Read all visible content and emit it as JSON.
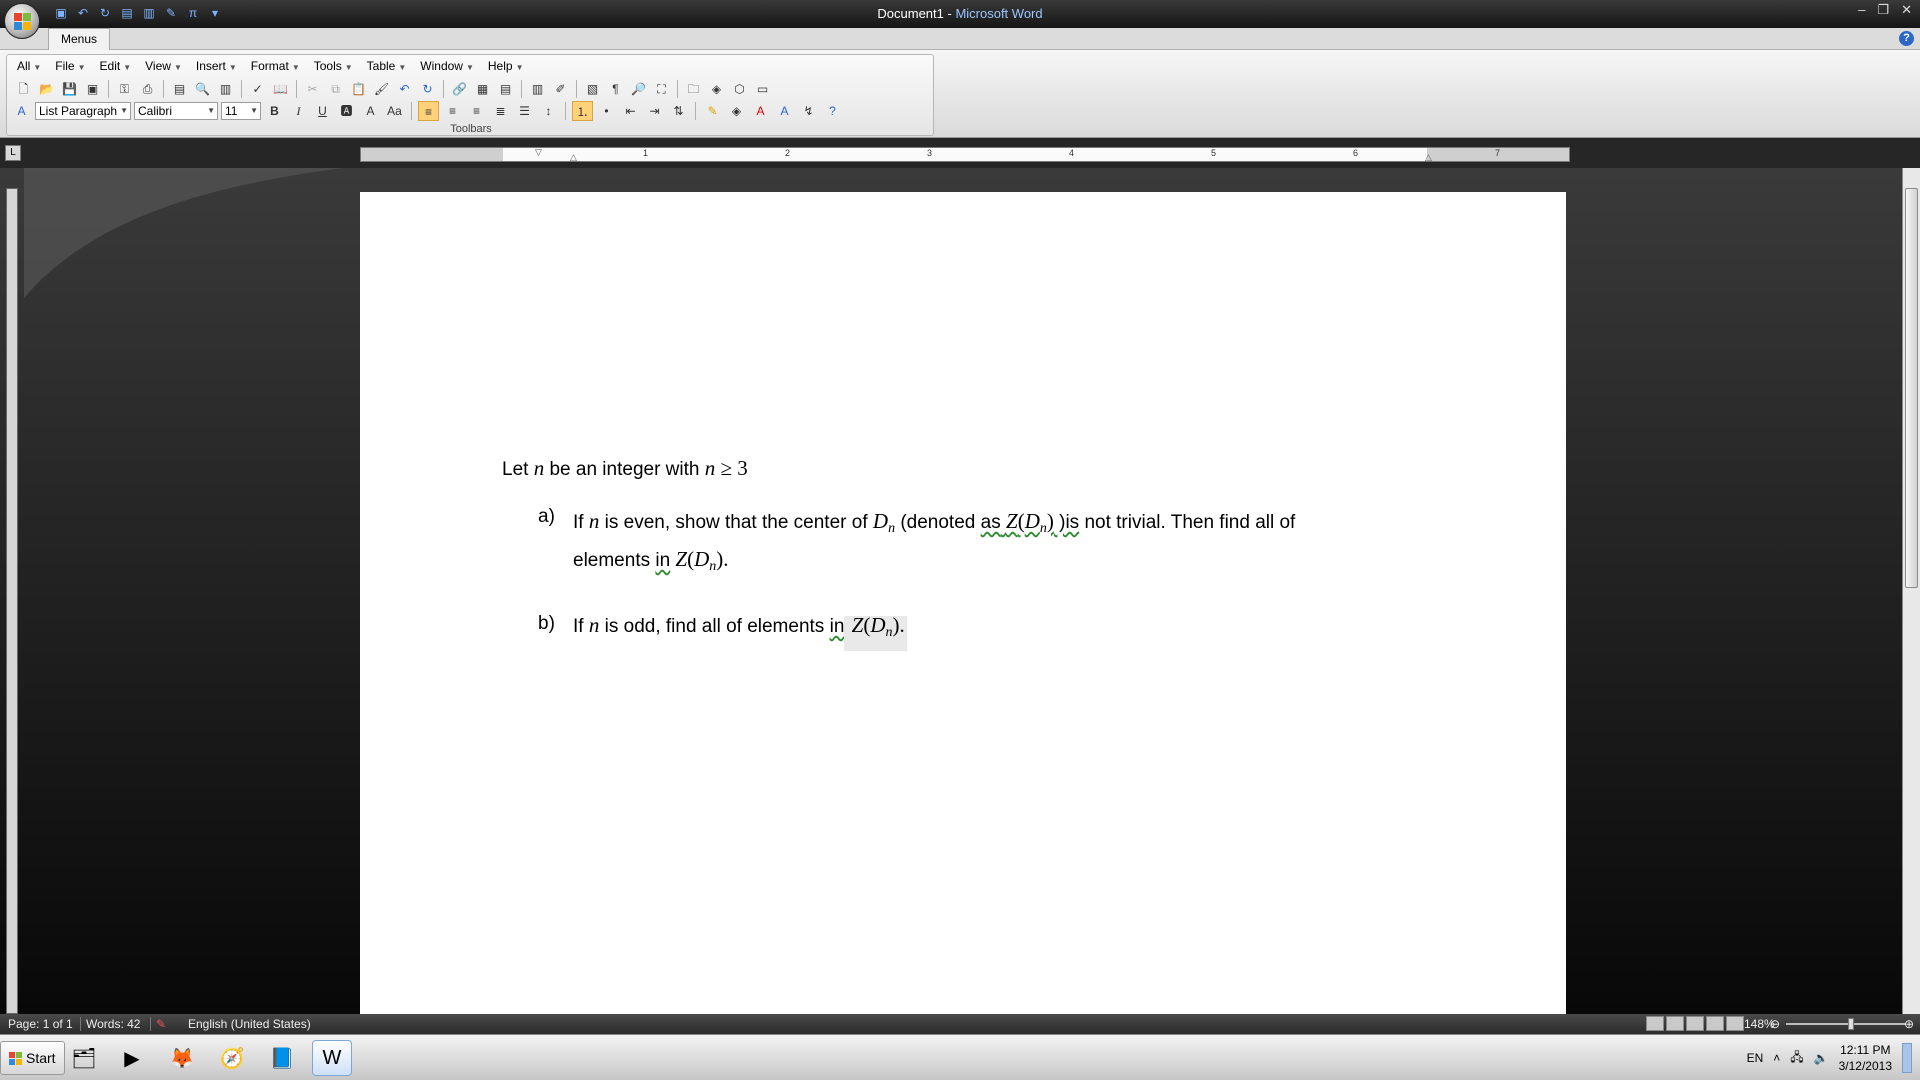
{
  "window": {
    "doc_name": "Document1",
    "separator": " - ",
    "app_name": "Microsoft Word"
  },
  "tabs": {
    "menus": "Menus"
  },
  "menus": [
    {
      "label": "All"
    },
    {
      "label": "File"
    },
    {
      "label": "Edit"
    },
    {
      "label": "View"
    },
    {
      "label": "Insert"
    },
    {
      "label": "Format"
    },
    {
      "label": "Tools"
    },
    {
      "label": "Table"
    },
    {
      "label": "Window"
    },
    {
      "label": "Help"
    }
  ],
  "formatting": {
    "style": "List Paragraph",
    "font": "Calibri",
    "size": "11",
    "bold": "B",
    "italic": "I",
    "underline": "U",
    "change_case": "Aa"
  },
  "ribbon": {
    "group_label": "Toolbars"
  },
  "ruler": {
    "numbers": [
      "1",
      "2",
      "3",
      "4",
      "5",
      "6",
      "7"
    ]
  },
  "document": {
    "intro_prefix": "Let ",
    "intro_var": "n",
    "intro_mid": " be an integer with ",
    "intro_expr_var": "n",
    "intro_expr_rel": " ≥ 3",
    "a_label": "a)",
    "a_text1": "If ",
    "a_var": "n",
    "a_text2": " is even, show that the center of ",
    "a_D": "D",
    "a_sub": "n",
    "a_text3": " (denoted ",
    "a_as": "as",
    "a_Z": "Z",
    "a_paren_open": "(",
    "a_D2": "D",
    "a_sub2": "n",
    "a_paren_close": ")",
    "a_is": " )is",
    "a_text4": " not trivial. Then find all of",
    "a_line2_prefix": "elements ",
    "a_in": "in",
    "a_line2_Z": " Z",
    "a_line2_open": "(",
    "a_line2_D": "D",
    "a_line2_sub": "n",
    "a_line2_close": ").",
    "b_label": "b)",
    "b_text1": "If ",
    "b_var": "n",
    "b_text2": " is odd, find all of elements ",
    "b_in": "in",
    "b_Z": " Z",
    "b_open": "(",
    "b_D": "D",
    "b_sub": "n",
    "b_close": ").",
    "period_tail": ""
  },
  "status": {
    "page": "Page: 1 of 1",
    "words": "Words: 42",
    "language": "English (United States)",
    "zoom": "148%"
  },
  "taskbar": {
    "start": "Start",
    "lang": "EN",
    "time": "12:11 PM",
    "date": "3/12/2013"
  },
  "colors": {
    "accent": "#2b66c9",
    "title_bg": "#151515",
    "page_bg": "#ffffff"
  }
}
